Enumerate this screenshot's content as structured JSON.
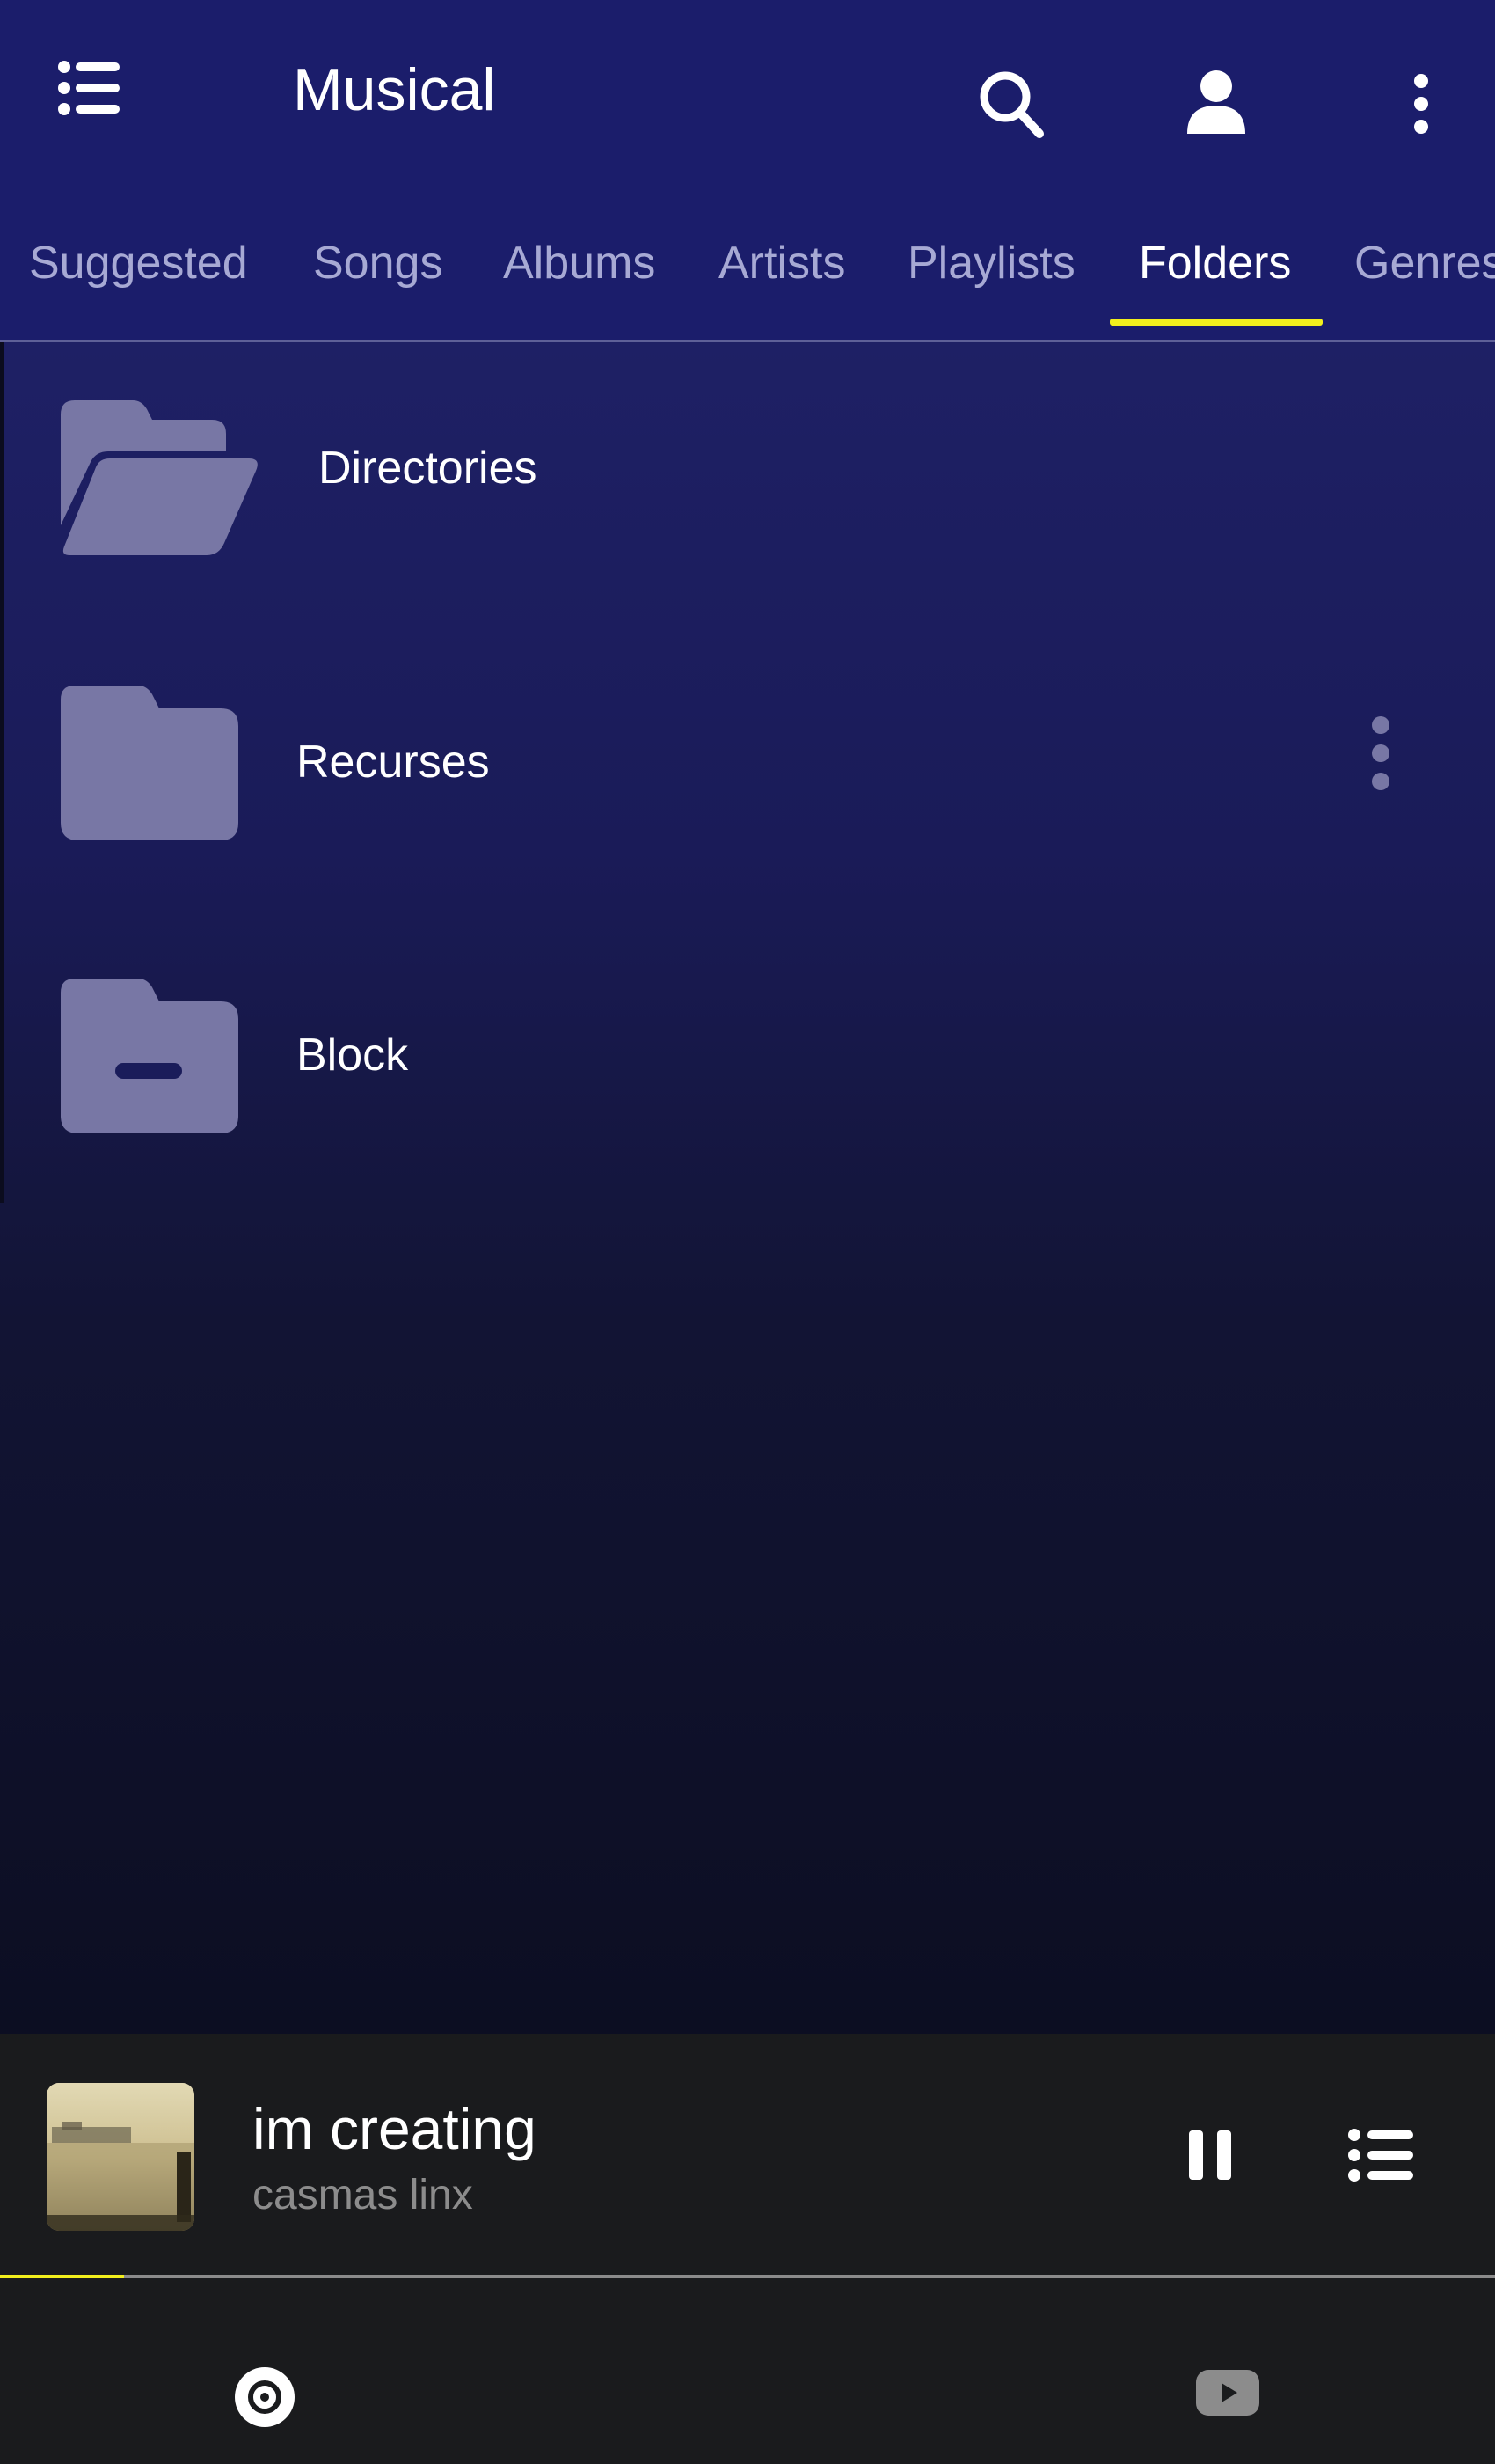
{
  "header": {
    "title": "Musical",
    "icons": [
      "list-icon",
      "search-icon",
      "account-icon",
      "more-vert-icon"
    ]
  },
  "tabs": [
    {
      "label": "Suggested",
      "active": false
    },
    {
      "label": "Songs",
      "active": false
    },
    {
      "label": "Albums",
      "active": false
    },
    {
      "label": "Artists",
      "active": false
    },
    {
      "label": "Playlists",
      "active": false
    },
    {
      "label": "Folders",
      "active": true
    },
    {
      "label": "Genres",
      "active": false
    }
  ],
  "folders": [
    {
      "label": "Directories",
      "icon": "folder-open-icon",
      "has_menu": false
    },
    {
      "label": "Recurses",
      "icon": "folder-icon",
      "has_menu": true
    },
    {
      "label": "Block",
      "icon": "folder-block-icon",
      "has_menu": false
    }
  ],
  "now_playing": {
    "title": "im creating",
    "artist": "casmas linx",
    "progress_fraction": 0.083
  },
  "bottom_nav": [
    {
      "name": "local",
      "icon": "disc-icon",
      "active": true
    },
    {
      "name": "youtube",
      "icon": "youtube-icon",
      "active": false
    }
  ],
  "colors": {
    "primary": "#1b1d6b",
    "accent": "#f2ef1d",
    "folder_icon": "#7877a5",
    "player_bg": "#1a1b1d"
  }
}
